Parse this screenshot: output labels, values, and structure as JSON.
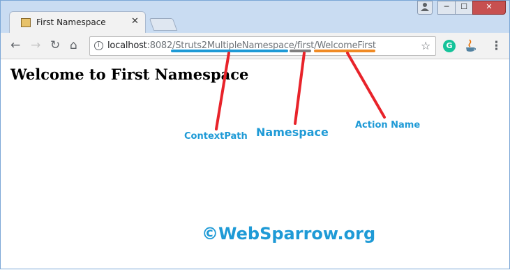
{
  "window": {
    "controls": {
      "user": "user-icon",
      "minimize": "─",
      "maximize": "☐",
      "close": "✕"
    }
  },
  "tab": {
    "title": "First Namespace",
    "close": "✕"
  },
  "toolbar": {
    "back": "←",
    "forward": "→",
    "reload": "↻",
    "home": "⌂",
    "info_icon": "i",
    "url_host": "localhost",
    "url_rest": ":8082/Struts2MultipleNamespace/first/WelcomeFirst",
    "star": "☆",
    "grammarly": "G",
    "menu": "⋮"
  },
  "page": {
    "heading": "Welcome to First Namespace"
  },
  "annotations": {
    "context_path": "ContextPath",
    "namespace": "Namespace",
    "action_name": "Action Name",
    "colors": {
      "context_path": "#1e9ad6",
      "namespace": "#7f7f7f",
      "action_name": "#f08a24",
      "pointer": "#e8232a"
    }
  },
  "watermark": "©WebSparrow.org"
}
